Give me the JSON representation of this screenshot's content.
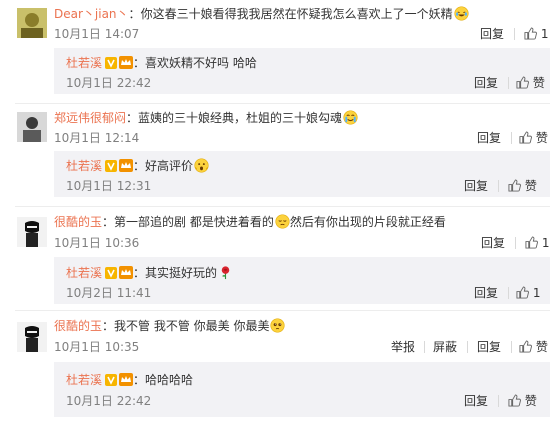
{
  "comments": [
    {
      "user": "Dear丶jian丶",
      "text": "你这春三十娘看得我我居然在怀疑我怎么喜欢上了一个妖精",
      "emoji": "laughing-tears-emoji",
      "time": "10月1日 14:07",
      "reply_label": "回复",
      "like_count": "1",
      "reply": {
        "user": "杜若溪",
        "text": "喜欢妖精不好吗 哈哈",
        "time": "10月1日 22:42",
        "reply_label": "回复",
        "like_label": "赞"
      }
    },
    {
      "user": "郑远伟很郁闷",
      "text": "蓝姨的三十娘经典，杜姐的三十娘勾魂",
      "emoji": "crying-laughing-emoji",
      "time": "10月1日 12:14",
      "reply_label": "回复",
      "like_label": "赞",
      "reply": {
        "user": "杜若溪",
        "text": "好高评价",
        "emoji": "surprised-face-emoji",
        "time": "10月1日 12:31",
        "reply_label": "回复",
        "like_label": "赞"
      }
    },
    {
      "user": "很酷的玉",
      "text_a": "第一部追的剧 都是快进着看的",
      "text_b": "然后有你出现的片段就正经看",
      "emoji": "relieved-face-emoji",
      "time": "10月1日 10:36",
      "reply_label": "回复",
      "like_count": "1",
      "reply": {
        "user": "杜若溪",
        "text": "其实挺好玩的",
        "emoji": "rose-emoji",
        "time": "10月2日 11:41",
        "reply_label": "回复",
        "like_count": "1"
      }
    },
    {
      "user": "很酷的玉",
      "text": "我不管 我不管 你最美 你最美",
      "emoji": "pleading-face-emoji",
      "time": "10月1日 10:35",
      "report_label": "举报",
      "block_label": "屏蔽",
      "reply_label": "回复",
      "like_label": "赞",
      "reply": {
        "user": "杜若溪",
        "text": "哈哈哈哈",
        "time": "10月1日 22:42",
        "reply_label": "回复",
        "like_label": "赞"
      }
    }
  ],
  "colors": {
    "username": "#eb7350",
    "meta": "#808080",
    "reply_bg": "#f2f2f5",
    "verified": "#f7b500",
    "member_crown": "#f29100"
  },
  "icons": {
    "thumb": "thumbs-up-icon",
    "verified": "verified-v-badge-icon",
    "member": "member-crown-icon"
  }
}
